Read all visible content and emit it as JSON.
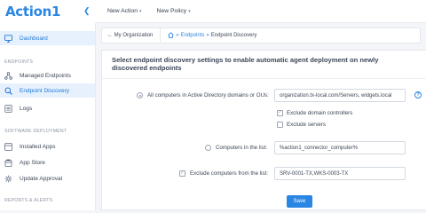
{
  "app": {
    "logo": "Action1"
  },
  "topbar": {
    "new_action": "New Action",
    "new_policy": "New Policy"
  },
  "sidebar": {
    "items": [
      {
        "label": "Dashboard",
        "icon": "monitor-icon",
        "active": true
      },
      {
        "label": "Managed Endpoints",
        "icon": "network-icon"
      },
      {
        "label": "Endpoint Discovery",
        "icon": "search-icon",
        "active": true
      },
      {
        "label": "Logs",
        "icon": "list-icon"
      },
      {
        "label": "Installed Apps",
        "icon": "apps-icon"
      },
      {
        "label": "App Store",
        "icon": "store-icon"
      },
      {
        "label": "Update Approval",
        "icon": "gear-icon"
      }
    ],
    "sections": {
      "endpoints": "ENDPOINTS",
      "software": "SOFTWARE DEPLOYMENT",
      "reports": "REPORTS & ALERTS"
    }
  },
  "breadcrumb": {
    "back": "← My Organization",
    "sep": "»",
    "endpoints": "Endpoints",
    "current": "Endpoint Discovery"
  },
  "card": {
    "title": "Select endpoint discovery settings to enable automatic agent deployment on newly discovered endpoints",
    "ad_label": "All computers in Active Directory domains or OUs:",
    "ad_value": "organization.tx-local.com/Servers, widgets.local",
    "help": "?",
    "exclude_dc": "Exclude domain controllers",
    "exclude_servers": "Exclude servers",
    "list_label": "Computers in the list:",
    "list_value": "%action1_connector_computer%",
    "exclude_list_label": "Exclude computers from the list:",
    "exclude_list_value": "SRV-0001-TX,WKS-0003-TX",
    "save": "Save"
  }
}
